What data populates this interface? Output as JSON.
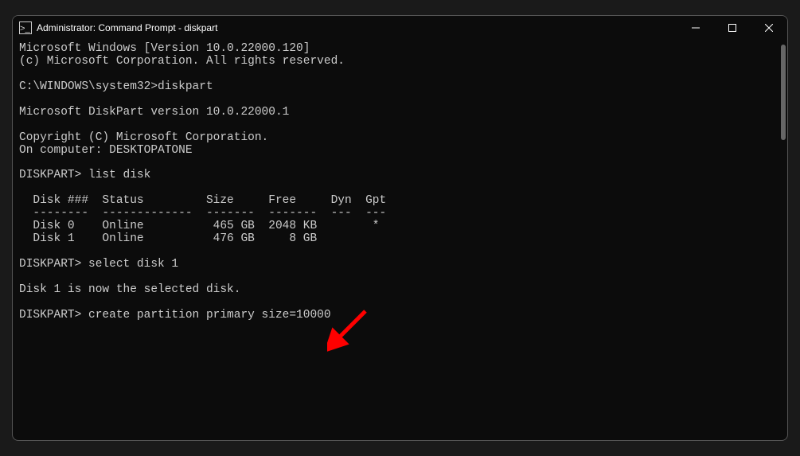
{
  "titlebar": {
    "icon_label": "cmd-icon",
    "title": "Administrator: Command Prompt - diskpart"
  },
  "controls": {
    "minimize": "Minimize",
    "maximize": "Maximize",
    "close": "Close"
  },
  "terminal": {
    "lines": [
      "Microsoft Windows [Version 10.0.22000.120]",
      "(c) Microsoft Corporation. All rights reserved.",
      "",
      "C:\\WINDOWS\\system32>diskpart",
      "",
      "Microsoft DiskPart version 10.0.22000.1",
      "",
      "Copyright (C) Microsoft Corporation.",
      "On computer: DESKTOPATONE",
      "",
      "DISKPART> list disk",
      "",
      "  Disk ###  Status         Size     Free     Dyn  Gpt",
      "  --------  -------------  -------  -------  ---  ---",
      "  Disk 0    Online          465 GB  2048 KB        *",
      "  Disk 1    Online          476 GB     8 GB",
      "",
      "DISKPART> select disk 1",
      "",
      "Disk 1 is now the selected disk.",
      "",
      "DISKPART> create partition primary size=10000"
    ]
  },
  "annotation": {
    "arrow_color": "#ff0000"
  }
}
